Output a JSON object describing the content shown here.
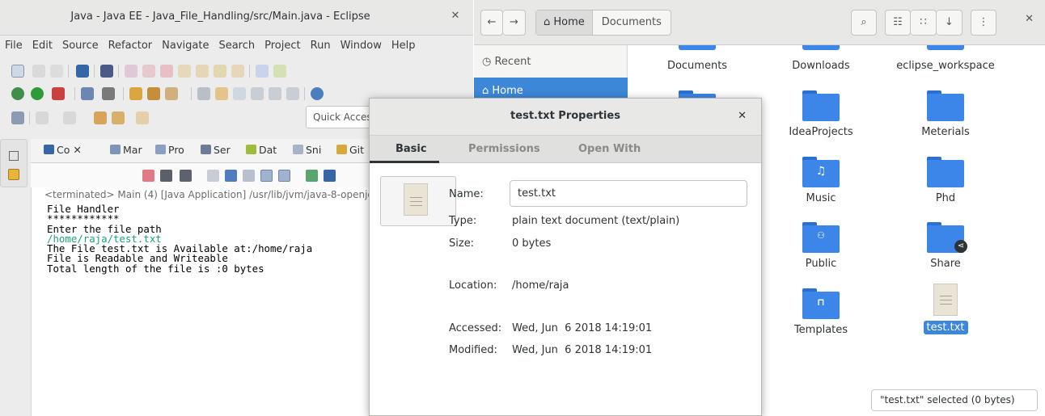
{
  "eclipse": {
    "title": "Java - Java EE - Java_File_Handling/src/Main.java - Eclipse",
    "menu": [
      "File",
      "Edit",
      "Source",
      "Refactor",
      "Navigate",
      "Search",
      "Project",
      "Run",
      "Window",
      "Help"
    ],
    "quick_access": "Quick Access",
    "view_tabs": [
      "Co",
      "Mar",
      "Pro",
      "Ser",
      "Dat",
      "Sni",
      "Git"
    ],
    "console_header": "<terminated> Main (4) [Java Application] /usr/lib/jvm/java-8-openjdk",
    "console_lines": {
      "l1": "File Handler",
      "l2": "************",
      "l3": "Enter the file path",
      "l4": "/home/raja/test.txt",
      "l5": "The File test.txt is Available at:/home/raja",
      "l6": "File is Readable and Writeable",
      "l7": "Total length of the file is :0 bytes"
    }
  },
  "files": {
    "breadcrumb": {
      "home": "Home",
      "current": "Documents"
    },
    "sidebar": [
      {
        "label": "Recent",
        "icon": "clock-icon"
      },
      {
        "label": "Home",
        "icon": "home-icon"
      }
    ],
    "items": [
      {
        "label": "Documents"
      },
      {
        "label": "Downloads"
      },
      {
        "label": "eclipse_workspace"
      },
      {
        "label": "IdeaProjects"
      },
      {
        "label": "Meterials"
      },
      {
        "label": "Music"
      },
      {
        "label": "Phd"
      },
      {
        "label": "Public"
      },
      {
        "label": "Share"
      },
      {
        "label": "Templates"
      },
      {
        "label": "test.txt"
      }
    ],
    "status": "\"test.txt\" selected  (0 bytes)",
    "accent": "#3d87d8"
  },
  "dialog": {
    "title": "test.txt Properties",
    "tabs": [
      "Basic",
      "Permissions",
      "Open With"
    ],
    "name_label": "Name:",
    "name_value": "test.txt",
    "type_label": "Type:",
    "type_value": "plain text document (text/plain)",
    "size_label": "Size:",
    "size_value": "0 bytes",
    "location_label": "Location:",
    "location_value": "/home/raja",
    "accessed_label": "Accessed:",
    "accessed_value": "Wed, Jun  6 2018 14:19:01",
    "modified_label": "Modified:",
    "modified_value": "Wed, Jun  6 2018 14:19:01"
  }
}
